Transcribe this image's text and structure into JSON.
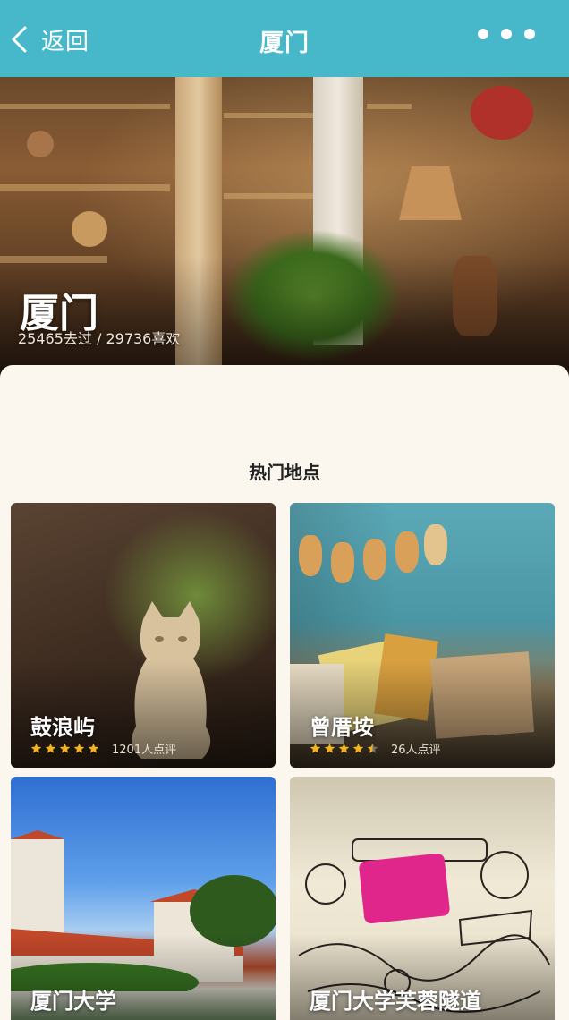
{
  "topbar": {
    "back_label": "返回",
    "title": "厦门",
    "bg_color": "#47b7ca"
  },
  "hero": {
    "title": "厦门",
    "stats": "25465去过 / 29736喜欢"
  },
  "section": {
    "title": "热门地点"
  },
  "places": [
    {
      "name": "鼓浪屿",
      "rating": 5,
      "reviews": "1201人点评"
    },
    {
      "name": "曾厝垵",
      "rating": 4.5,
      "reviews": "26人点评"
    },
    {
      "name": "厦门大学"
    },
    {
      "name": "厦门大学芙蓉隧道"
    }
  ],
  "icons": {
    "back": "chevron-left-icon",
    "more": "more-dots-icon",
    "star": "star-icon"
  },
  "colors": {
    "star": "#f5b51e",
    "panel_bg": "#fbf7ef"
  }
}
